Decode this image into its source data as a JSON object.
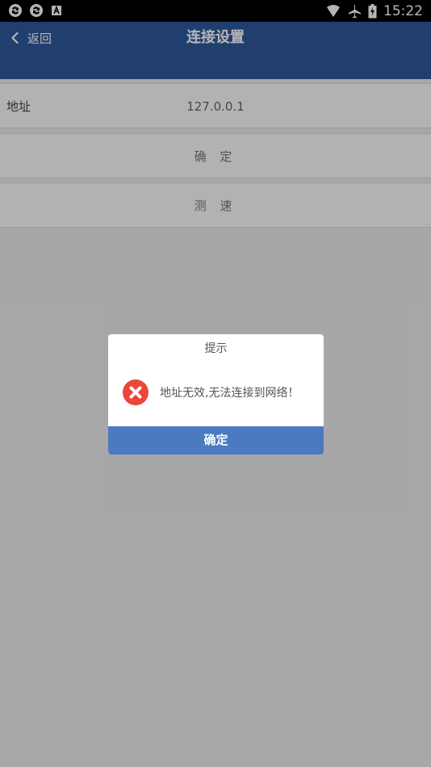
{
  "status_bar": {
    "time": "15:22"
  },
  "header": {
    "back_label": "返回",
    "title": "连接设置"
  },
  "rows": {
    "address_label": "地址",
    "address_value": "127.0.0.1",
    "confirm_label": "确 定",
    "speed_label": "测 速"
  },
  "dialog": {
    "title": "提示",
    "message": "地址无效,无法连接到网络！",
    "confirm_label": "确定",
    "error_icon": "error-circle-icon"
  },
  "colors": {
    "header_bg": "#2f5a9b",
    "dialog_button_bg": "#4c7ac0",
    "error_icon": "#e8473a"
  }
}
